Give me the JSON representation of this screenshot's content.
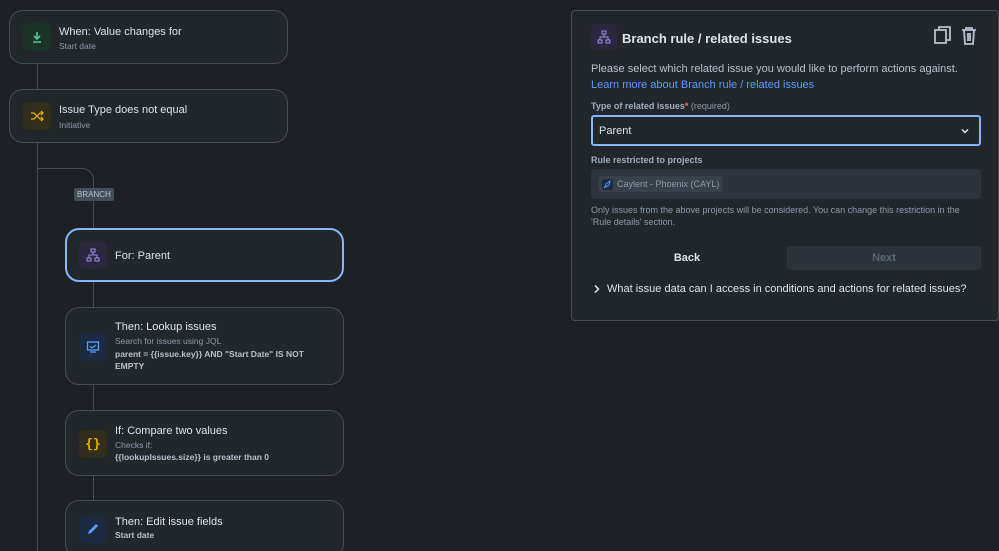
{
  "flow": {
    "trigger": {
      "title": "When: Value changes for",
      "subtitle": "Start date",
      "icon": "download-icon",
      "icon_color": "#4bce97",
      "icon_bg": "#1c3329"
    },
    "condition": {
      "title": "Issue Type does not equal",
      "subtitle": "Initiative",
      "icon": "shuffle-icon",
      "icon_color": "#e2b203",
      "icon_bg": "#332e1b"
    },
    "branch_tag": "BRANCH",
    "branch": {
      "title": "For: Parent",
      "icon": "hierarchy-icon",
      "icon_color": "#9f8fef",
      "icon_bg": "#2b273f"
    },
    "lookup": {
      "title": "Then: Lookup issues",
      "subtitle": "Search for issues using JQL",
      "detail": "parent = {{issue.key}} AND \"Start Date\" IS NOT EMPTY",
      "icon": "monitor-icon",
      "icon_color": "#579dff",
      "icon_bg": "#1c2b41"
    },
    "compare": {
      "title": "If: Compare two values",
      "subtitle": "Checks if:",
      "detail": "{{lookupIssues.size}} is greater than 0",
      "icon": "braces-icon",
      "icon_color": "#e2b203",
      "icon_bg": "#332e1b"
    },
    "edit": {
      "title": "Then: Edit issue fields",
      "detail": "Start date",
      "icon": "pencil-icon",
      "icon_color": "#579dff",
      "icon_bg": "#1c2b41"
    }
  },
  "panel": {
    "title": "Branch rule / related issues",
    "description": "Please select which related issue you would like to perform actions against. ",
    "link": "Learn more about Branch rule / related issues",
    "type_label": "Type of related issues",
    "required_star": "*",
    "required_text": "(required)",
    "type_value": "Parent",
    "projects_label": "Rule restricted to projects",
    "project_chip": "Caylent - Phoenix (CAYL)",
    "helper": "Only issues from the above projects will be considered. You can change this restriction in the 'Rule details' section.",
    "back_label": "Back",
    "next_label": "Next",
    "faq": "What issue data can I access in conditions and actions for related issues?"
  },
  "colors": {
    "accent": "#85b8ff",
    "link": "#579dff",
    "background": "#1d2125",
    "surface": "#22272b"
  }
}
